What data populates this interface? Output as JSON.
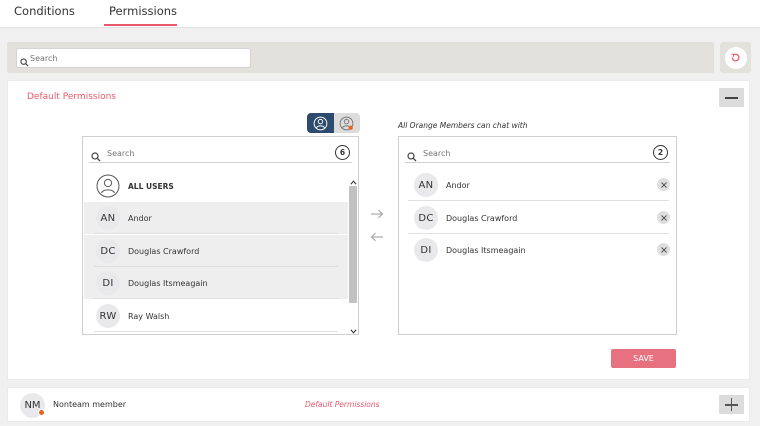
{
  "tabs": [
    {
      "label": "Conditions"
    },
    {
      "label": "Permissions"
    }
  ],
  "top_search": {
    "placeholder": "Search"
  },
  "default_section": {
    "title": "Default Permissions",
    "right_caption": "All Orange Members can chat with",
    "available": {
      "search_placeholder": "Search",
      "count": "6",
      "all_users_label": "ALL USERS",
      "users": [
        {
          "initials": "AN",
          "name": "Andor"
        },
        {
          "initials": "DC",
          "name": "Douglas Crawford"
        },
        {
          "initials": "DI",
          "name": "Douglas Itsmeagain"
        },
        {
          "initials": "RW",
          "name": "Ray Walsh"
        }
      ]
    },
    "selected": {
      "search_placeholder": "Search",
      "count": "2",
      "users": [
        {
          "initials": "AN",
          "name": "Andor"
        },
        {
          "initials": "DC",
          "name": "Douglas Crawford"
        },
        {
          "initials": "DI",
          "name": "Douglas Itsmeagain"
        }
      ]
    },
    "save_label": "SAVE"
  },
  "member_row": {
    "initials": "NM",
    "name": "Nonteam member",
    "permissions_label": "Default Permissions"
  },
  "colors": {
    "accent": "#e8596b",
    "toggle_active": "#2c4b6e",
    "status_dot": "#e56423"
  }
}
